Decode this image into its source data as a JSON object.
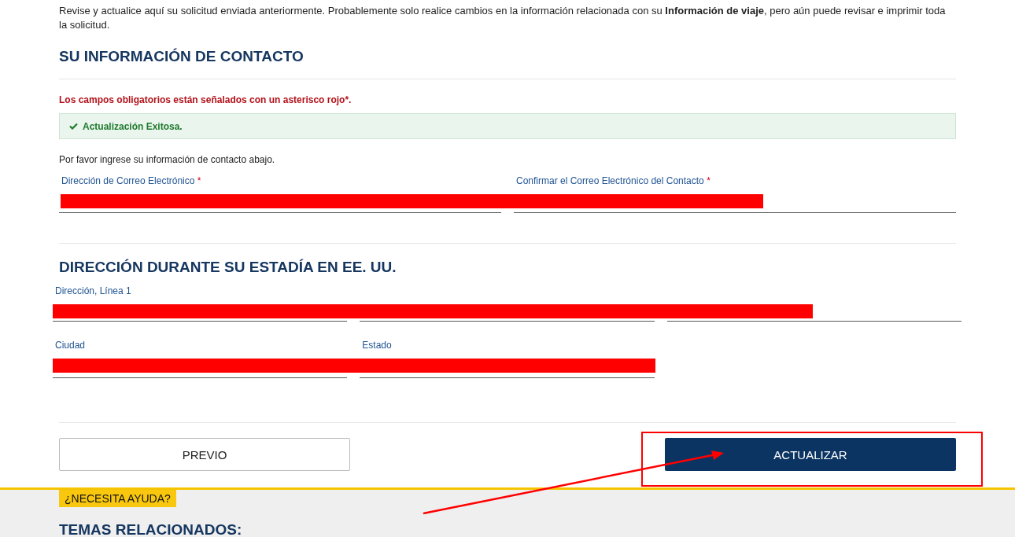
{
  "intro": "Revise y actualice aquí su solicitud enviada anteriormente. Probablemente solo realice cambios en la información relacionada con su **Información de viaje**, pero aún puede revisar e imprimir toda la solicitud.",
  "contact": {
    "heading": "SU INFORMACIÓN DE CONTACTO",
    "required_note": "Los campos obligatorios están señalados con un asterisco rojo*.",
    "alert": "Actualización Exitosa.",
    "instruction": "Por favor ingrese su información de contacto abajo.",
    "fields": [
      {
        "label": "Dirección de Correo Electrónico",
        "required_mark": "*"
      },
      {
        "label": "Confirmar el Correo Electrónico del Contacto",
        "required_mark": "*"
      }
    ]
  },
  "address": {
    "heading": "DIRECCIÓN DURANTE SU ESTADÍA EN EE. UU.",
    "rows": [
      [
        {
          "label": "Dirección, Línea 1"
        },
        {},
        {}
      ],
      [
        {
          "label": "Ciudad"
        },
        {
          "label": "Estado"
        }
      ]
    ]
  },
  "buttons": [
    {
      "label": "PREVIO",
      "kind": "secondary"
    },
    {
      "label": "ACTUALIZAR",
      "kind": "primary"
    }
  ],
  "help": {
    "badge": "¿NECESITA AYUDA?",
    "heading": "TEMAS RELACIONADOS:"
  }
}
